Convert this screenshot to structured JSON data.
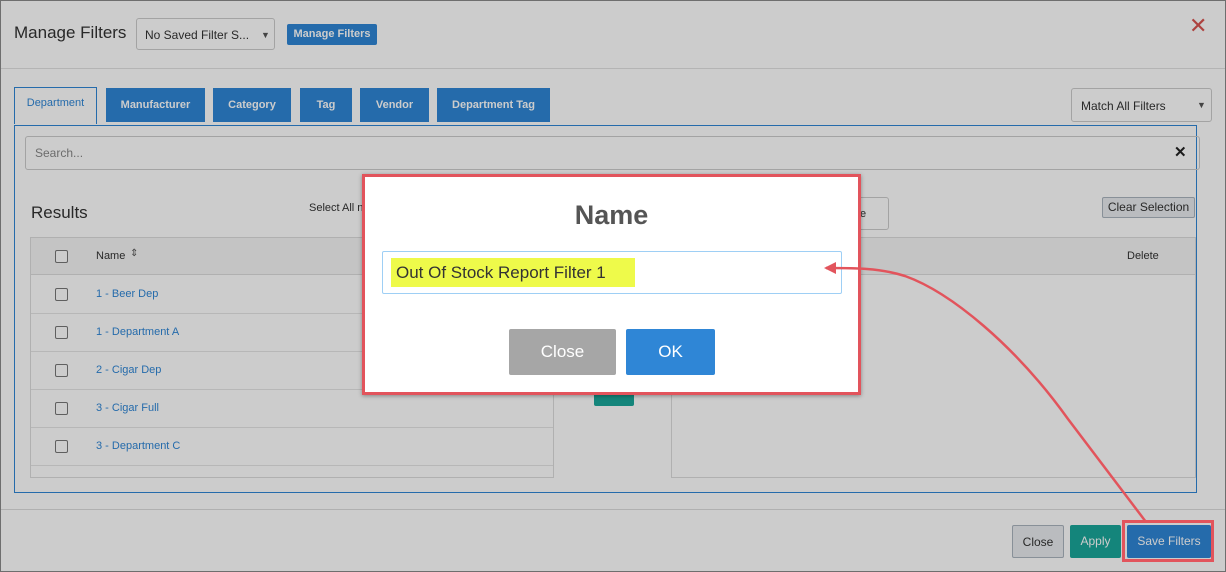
{
  "header": {
    "title": "Manage Filters",
    "saved_filter_select": "No Saved Filter S...",
    "manage_button": "Manage Filters",
    "close_icon": "close-icon"
  },
  "tabs": [
    {
      "label": "Department",
      "active": true
    },
    {
      "label": "Manufacturer",
      "active": false
    },
    {
      "label": "Category",
      "active": false
    },
    {
      "label": "Tag",
      "active": false
    },
    {
      "label": "Vendor",
      "active": false
    },
    {
      "label": "Department Tag",
      "active": false
    }
  ],
  "match_select": "Match All Filters",
  "search": {
    "placeholder": "Search..."
  },
  "results": {
    "title": "Results",
    "select_all_label": "Select All n",
    "name_header": "Name",
    "rows": [
      "1 - Beer Dep",
      "1 - Department A",
      "2 - Cigar Dep",
      "3 - Cigar Full",
      "3 - Department C"
    ]
  },
  "selected": {
    "partial_label": "e",
    "clear_selection": "Clear Selection",
    "delete_header": "Delete"
  },
  "modal": {
    "title": "Name",
    "input_value": "Out Of Stock Report Filter 1",
    "close_label": "Close",
    "ok_label": "OK"
  },
  "footer": {
    "close": "Close",
    "apply": "Apply",
    "save": "Save Filters"
  },
  "colors": {
    "primary": "#2f86d6",
    "teal": "#1aa79a",
    "annotation_red": "#e2545c",
    "highlight": "#eefa4a"
  }
}
